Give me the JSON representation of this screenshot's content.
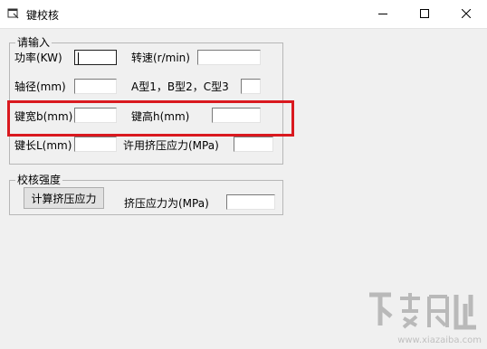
{
  "window": {
    "title": "键校核",
    "controls": [
      "minimize-icon",
      "maximize-icon",
      "close-icon"
    ]
  },
  "input_group": {
    "legend": "请输入",
    "power_label": "功率(KW)",
    "power_value": "",
    "speed_label": "转速(r/min)",
    "speed_value": "",
    "shaft_label": "轴径(mm)",
    "shaft_value": "",
    "type_label": "A型1，B型2，C型3",
    "type_value": "",
    "width_label": "键宽b(mm)",
    "width_value": "",
    "height_label": "键高h(mm)",
    "height_value": "",
    "length_label": "键长L(mm)",
    "length_value": "",
    "allow_label": "许用挤压应力(MPa)",
    "allow_value": ""
  },
  "check_group": {
    "legend": "校核强度",
    "calc_button": "计算挤压应力",
    "result_label": "挤压应力为(MPa)",
    "result_value": ""
  },
  "watermark": {
    "text": "www.xiazaiba.com"
  },
  "colors": {
    "highlight": "#d9191f",
    "window_bg": "#f0f0f0"
  }
}
